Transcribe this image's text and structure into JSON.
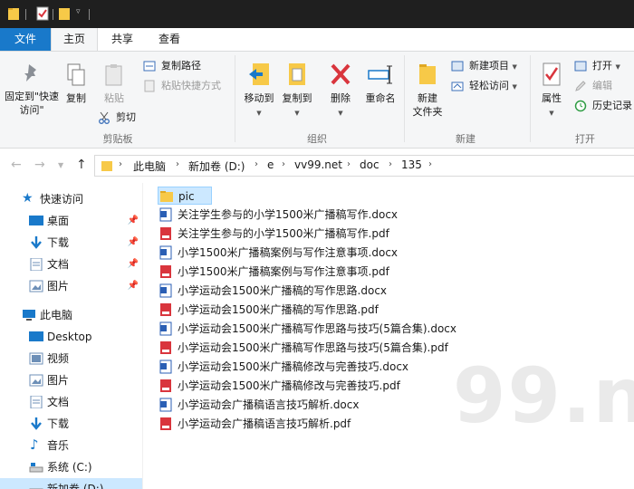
{
  "colors": {
    "accent": "#1979ca",
    "selection": "#cce8ff",
    "folder": "#f7c948",
    "pdf": "#d9353d",
    "docx": "#2b5fb4"
  },
  "tabs": {
    "file": "文件",
    "home": "主页",
    "share": "共享",
    "view": "查看"
  },
  "ribbon": {
    "clipboard": {
      "group_label": "剪贴板",
      "pin_quick_access": "固定到\"快速访问\"",
      "copy": "复制",
      "paste": "粘贴",
      "copy_path": "复制路径",
      "paste_shortcut": "粘贴快捷方式",
      "cut": "剪切"
    },
    "organize": {
      "group_label": "组织",
      "move_to": "移动到",
      "copy_to": "复制到",
      "delete": "删除",
      "rename": "重命名"
    },
    "new": {
      "group_label": "新建",
      "new_folder": "新建\n文件夹",
      "new_item": "新建项目",
      "easy_access": "轻松访问"
    },
    "open": {
      "group_label": "打开",
      "properties": "属性",
      "open": "打开",
      "edit": "编辑",
      "history": "历史记录"
    }
  },
  "address": {
    "breadcrumbs": [
      "此电脑",
      "新加卷 (D:)",
      "e",
      "vv99.net",
      "doc",
      "135"
    ]
  },
  "navpane": {
    "quick_access": "快速访问",
    "quick_items": [
      "桌面",
      "下载",
      "文档",
      "图片"
    ],
    "this_pc": "此电脑",
    "pc_items": [
      "Desktop",
      "视频",
      "图片",
      "文档",
      "下载",
      "音乐",
      "系统 (C:)",
      "新加卷 (D:)"
    ]
  },
  "files": [
    {
      "name": "pic",
      "type": "folder"
    },
    {
      "name": "关注学生参与的小学1500米广播稿写作.docx",
      "type": "docx"
    },
    {
      "name": "关注学生参与的小学1500米广播稿写作.pdf",
      "type": "pdf"
    },
    {
      "name": "小学1500米广播稿案例与写作注意事项.docx",
      "type": "docx"
    },
    {
      "name": "小学1500米广播稿案例与写作注意事项.pdf",
      "type": "pdf"
    },
    {
      "name": "小学运动会1500米广播稿的写作思路.docx",
      "type": "docx"
    },
    {
      "name": "小学运动会1500米广播稿的写作思路.pdf",
      "type": "pdf"
    },
    {
      "name": "小学运动会1500米广播稿写作思路与技巧(5篇合集).docx",
      "type": "docx"
    },
    {
      "name": "小学运动会1500米广播稿写作思路与技巧(5篇合集).pdf",
      "type": "pdf"
    },
    {
      "name": "小学运动会1500米广播稿修改与完善技巧.docx",
      "type": "docx"
    },
    {
      "name": "小学运动会1500米广播稿修改与完善技巧.pdf",
      "type": "pdf"
    },
    {
      "name": "小学运动会广播稿语言技巧解析.docx",
      "type": "docx"
    },
    {
      "name": "小学运动会广播稿语言技巧解析.pdf",
      "type": "pdf"
    }
  ],
  "watermark": "99.net"
}
